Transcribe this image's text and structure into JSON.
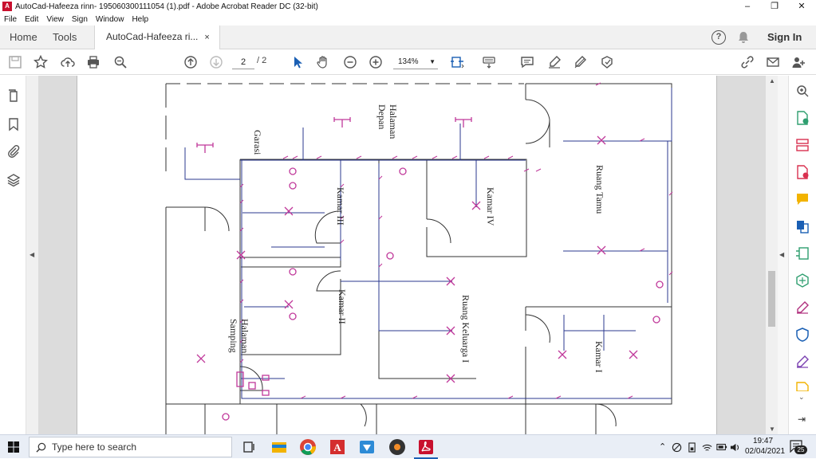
{
  "window": {
    "title": "AutoCad-Hafeeza rinn- 195060300111054 (1).pdf - Adobe Acrobat Reader DC (32-bit)",
    "minimize": "–",
    "maximize": "❐",
    "close": "✕"
  },
  "menu": [
    "File",
    "Edit",
    "View",
    "Sign",
    "Window",
    "Help"
  ],
  "tabs": {
    "home": "Home",
    "tools": "Tools",
    "document": "AutoCad-Hafeeza ri...",
    "close": "×",
    "signin": "Sign In"
  },
  "toolbar": {
    "page_current": "2",
    "page_total": "/  2",
    "zoom": "134%"
  },
  "drawing": {
    "rooms": {
      "garasi": "Garasi",
      "halaman_depan": "Halaman Depan",
      "kamar_iii": "Kamar III",
      "kamar_iv": "Kamar IV",
      "ruang_tamu": "Ruang Tamu",
      "kamar_ii": "Kamar II",
      "ruang_keluarga": "Ruang Keluarga I",
      "halaman_samping": "Halaman Samping",
      "kamar_i": "Kamar I"
    }
  },
  "taskbar": {
    "search_placeholder": "Type here to search",
    "time": "19:47",
    "date": "02/04/2021",
    "notifications": "25"
  },
  "colors": {
    "accent_red": "#c8102e",
    "wire_blue": "#2b3a8f",
    "fixture_magenta": "#c0389a",
    "wall": "#333333"
  }
}
